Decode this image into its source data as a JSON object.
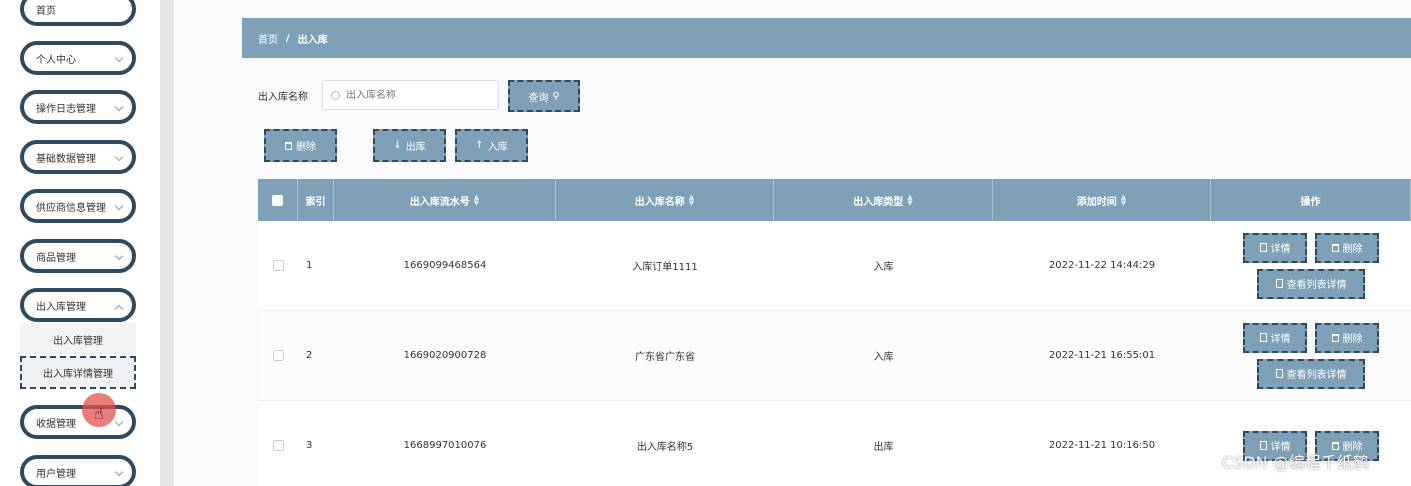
{
  "sidebar": {
    "items": [
      {
        "label": "首页"
      },
      {
        "label": "个人中心"
      },
      {
        "label": "操作日志管理"
      },
      {
        "label": "基础数据管理"
      },
      {
        "label": "供应商信息管理"
      },
      {
        "label": "商品管理"
      },
      {
        "label": "出入库管理"
      },
      {
        "label": "收据管理"
      },
      {
        "label": "用户管理"
      }
    ],
    "submenu": [
      {
        "label": "出入库管理"
      },
      {
        "label": "出入库详情管理"
      }
    ]
  },
  "breadcrumb": {
    "home": "首页",
    "separator": "/",
    "current": "出入库"
  },
  "search": {
    "label": "出入库名称",
    "placeholder": "出入库名称",
    "value": "",
    "button": "查询"
  },
  "actions": {
    "delete": "删除",
    "out": "出库",
    "in": "入库"
  },
  "table": {
    "headers": [
      "索引",
      "出入库流水号",
      "出入库名称",
      "出入库类型",
      "添加时间",
      "操作"
    ],
    "rows": [
      {
        "index": "1",
        "serial": "1669099468564",
        "name": "入库订单1111",
        "type": "入库",
        "time": "2022-11-22 14:44:29"
      },
      {
        "index": "2",
        "serial": "1669020900728",
        "name": "广东省广东省",
        "type": "入库",
        "time": "2022-11-21 16:55:01"
      },
      {
        "index": "3",
        "serial": "1668997010076",
        "name": "出入库名称5",
        "type": "出库",
        "time": "2022-11-21 10:16:50"
      }
    ],
    "row_actions": {
      "detail": "详情",
      "delete": "删除",
      "list_detail": "查看列表详情"
    }
  },
  "watermark": "CSDN @编程千纸鹤",
  "colors": {
    "accent": "#7fa1b8",
    "border": "#2e4a60"
  }
}
